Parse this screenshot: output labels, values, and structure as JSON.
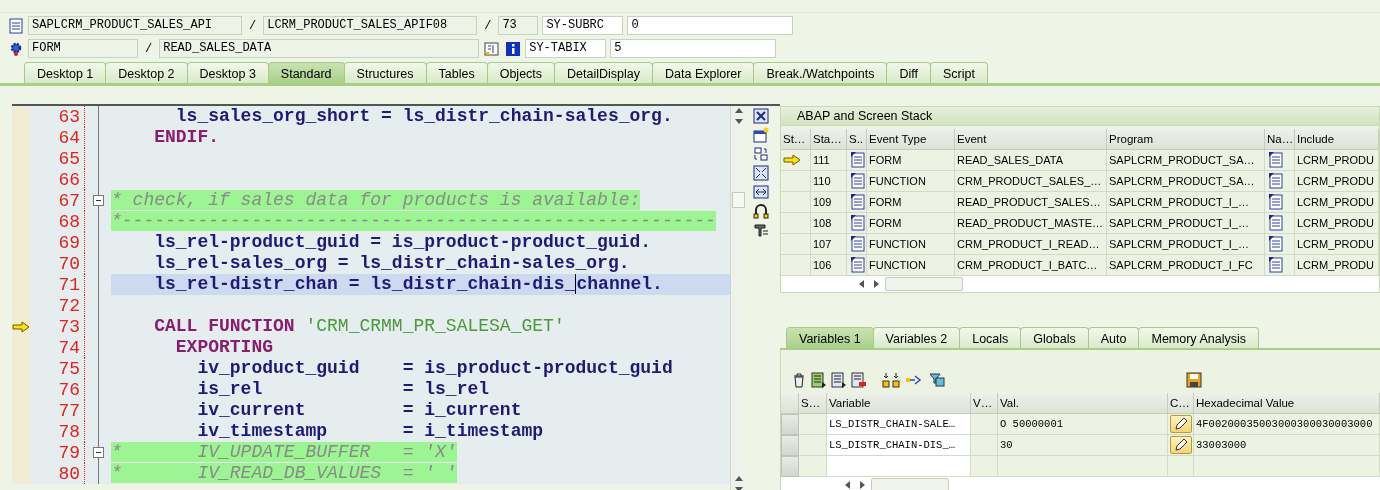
{
  "header": {
    "program": "SAPLCRM_PRODUCT_SALES_API",
    "separator": "/",
    "include": "LCRM_PRODUCT_SALES_APIF08",
    "line": "73",
    "event_type": "FORM",
    "event": "READ_SALES_DATA",
    "sys_fields": [
      {
        "name": "SY-SUBRC",
        "value": "0"
      },
      {
        "name": "SY-TABIX",
        "value": "5"
      }
    ]
  },
  "tabs": [
    {
      "label": "Desktop 1",
      "selected": false
    },
    {
      "label": "Desktop 2",
      "selected": false
    },
    {
      "label": "Desktop 3",
      "selected": false
    },
    {
      "label": "Standard",
      "selected": true
    },
    {
      "label": "Structures",
      "selected": false
    },
    {
      "label": "Tables",
      "selected": false
    },
    {
      "label": "Objects",
      "selected": false
    },
    {
      "label": "DetailDisplay",
      "selected": false
    },
    {
      "label": "Data Explorer",
      "selected": false
    },
    {
      "label": "Break./Watchpoints",
      "selected": false
    },
    {
      "label": "Diff",
      "selected": false
    },
    {
      "label": "Script",
      "selected": false
    }
  ],
  "editor": {
    "lines": [
      {
        "number": "63",
        "current": false,
        "selected": false,
        "fold": false,
        "tokens": [
          {
            "kind": "name",
            "text": "      ls_sales_org_short = ls_distr_chain-sales_org."
          }
        ]
      },
      {
        "number": "64",
        "current": false,
        "selected": false,
        "fold": false,
        "tokens": [
          {
            "kind": "keyword",
            "text": "    ENDIF."
          }
        ]
      },
      {
        "number": "65",
        "current": false,
        "selected": false,
        "fold": false
      },
      {
        "number": "66",
        "current": false,
        "selected": false,
        "fold": false
      },
      {
        "number": "67",
        "current": false,
        "selected": false,
        "fold": true,
        "tokens": [
          {
            "kind": "comment",
            "text": "* check, if sales data for products is available:"
          }
        ]
      },
      {
        "number": "68",
        "current": false,
        "selected": false,
        "fold": false,
        "tokens": [
          {
            "kind": "comment",
            "text": "*-------------------------------------------------------"
          }
        ]
      },
      {
        "number": "69",
        "current": false,
        "selected": false,
        "fold": false,
        "tokens": [
          {
            "kind": "name",
            "text": "    ls_rel-product_guid = is_product-product_guid."
          }
        ]
      },
      {
        "number": "70",
        "current": false,
        "selected": false,
        "fold": false,
        "tokens": [
          {
            "kind": "name",
            "text": "    ls_rel-sales_org = ls_distr_chain-sales_org."
          }
        ]
      },
      {
        "number": "71",
        "current": false,
        "selected": true,
        "fold": false,
        "tokens": [
          {
            "kind": "name",
            "text": "    ls_rel-distr_chan = ls_distr_chain-dis_"
          },
          {
            "kind": "name",
            "text": "channel.",
            "caret": true
          }
        ]
      },
      {
        "number": "72",
        "current": false,
        "selected": false,
        "fold": false
      },
      {
        "number": "73",
        "current": true,
        "selected": false,
        "fold": false,
        "tokens": [
          {
            "kind": "keyword",
            "text": "    CALL FUNCTION "
          },
          {
            "kind": "string",
            "text": "'CRM_CRMM_PR_SALESA_GET'"
          }
        ]
      },
      {
        "number": "74",
        "current": false,
        "selected": false,
        "fold": false,
        "tokens": [
          {
            "kind": "keyword",
            "text": "      EXPORTING"
          }
        ]
      },
      {
        "number": "75",
        "current": false,
        "selected": false,
        "fold": false,
        "tokens": [
          {
            "kind": "name",
            "text": "        iv_product_guid    = is_product-product_guid"
          }
        ]
      },
      {
        "number": "76",
        "current": false,
        "selected": false,
        "fold": false,
        "tokens": [
          {
            "kind": "name",
            "text": "        is_rel             = ls_rel"
          }
        ]
      },
      {
        "number": "77",
        "current": false,
        "selected": false,
        "fold": false,
        "tokens": [
          {
            "kind": "name",
            "text": "        iv_current         = i_current"
          }
        ]
      },
      {
        "number": "78",
        "current": false,
        "selected": false,
        "fold": false,
        "tokens": [
          {
            "kind": "name",
            "text": "        iv_timestamp       = i_timestamp"
          }
        ]
      },
      {
        "number": "79",
        "current": false,
        "selected": false,
        "fold": true,
        "tokens": [
          {
            "kind": "comment",
            "text": "*       IV_UPDATE_BUFFER   = 'X'"
          }
        ]
      },
      {
        "number": "80",
        "current": false,
        "selected": false,
        "fold": false,
        "tokens": [
          {
            "kind": "comment",
            "text": "*       IV_READ_DB_VALUES  = ' '"
          }
        ]
      }
    ]
  },
  "stack": {
    "title": "ABAP and Screen Stack",
    "columns": [
      "St…",
      "Sta…",
      "S..",
      "Event Type",
      "Event",
      "Program",
      "Na…",
      "Include"
    ],
    "rows": [
      {
        "current": true,
        "level": "111",
        "event_type": "FORM",
        "event": "READ_SALES_DATA",
        "program": "SAPLCRM_PRODUCT_SA…",
        "include": "LCRM_PRODU"
      },
      {
        "current": false,
        "level": "110",
        "event_type": "FUNCTION",
        "event": "CRM_PRODUCT_SALES_…",
        "program": "SAPLCRM_PRODUCT_SA…",
        "include": "LCRM_PRODU"
      },
      {
        "current": false,
        "level": "109",
        "event_type": "FORM",
        "event": "READ_PRODUCT_SALES…",
        "program": "SAPLCRM_PRODUCT_I_…",
        "include": "LCRM_PRODU"
      },
      {
        "current": false,
        "level": "108",
        "event_type": "FORM",
        "event": "READ_PRODUCT_MASTE…",
        "program": "SAPLCRM_PRODUCT_I_…",
        "include": "LCRM_PRODU"
      },
      {
        "current": false,
        "level": "107",
        "event_type": "FUNCTION",
        "event": "CRM_PRODUCT_I_READ…",
        "program": "SAPLCRM_PRODUCT_I_…",
        "include": "LCRM_PRODU"
      },
      {
        "current": false,
        "level": "106",
        "event_type": "FUNCTION",
        "event": "CRM_PRODUCT_I_BATC…",
        "program": "SAPLCRM_PRODUCT_I_FC",
        "include": "LCRM_PRODU"
      }
    ]
  },
  "variable_tabs": [
    {
      "label": "Variables 1",
      "selected": true
    },
    {
      "label": "Variables 2",
      "selected": false
    },
    {
      "label": "Locals",
      "selected": false
    },
    {
      "label": "Globals",
      "selected": false
    },
    {
      "label": "Auto",
      "selected": false
    },
    {
      "label": "Memory Analysis",
      "selected": false
    }
  ],
  "variables": {
    "columns": [
      "S…",
      "Variable",
      "V…",
      "Val.",
      "C…",
      "Hexadecimal Value"
    ],
    "rows": [
      {
        "variable": "LS_DISTR_CHAIN-SALE…",
        "value": "O 50000001",
        "hex": "4F00200035003000300030003000"
      },
      {
        "variable": "LS_DISTR_CHAIN-DIS_…",
        "value": "30",
        "hex": "33003000"
      }
    ]
  }
}
